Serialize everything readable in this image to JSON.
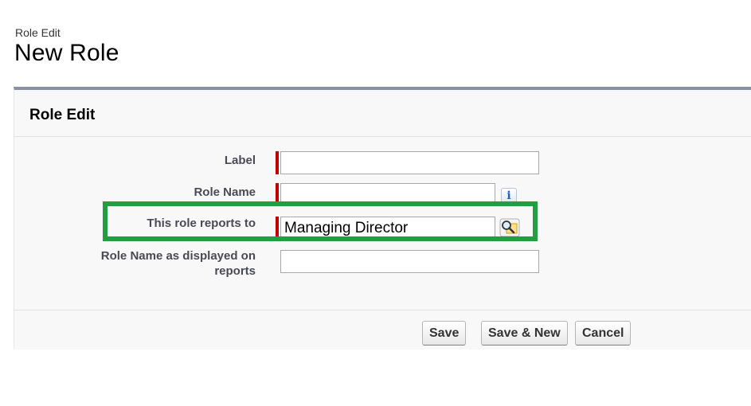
{
  "header": {
    "subtitle": "Role Edit",
    "title": "New Role"
  },
  "panel": {
    "title": "Role Edit",
    "fields": {
      "label": {
        "label": "Label",
        "value": ""
      },
      "role_name": {
        "label": "Role Name",
        "value": "",
        "info_icon": "info-icon"
      },
      "reports_to": {
        "label": "This role reports to",
        "value": "Managing Director",
        "lookup_icon": "lookup-magnifier-icon"
      },
      "display_name": {
        "label": "Role Name as displayed on reports",
        "value": ""
      }
    },
    "required_color": "#c00000",
    "highlight_color": "#1f9f3f"
  },
  "buttons": {
    "save": "Save",
    "save_new": "Save & New",
    "cancel": "Cancel"
  }
}
